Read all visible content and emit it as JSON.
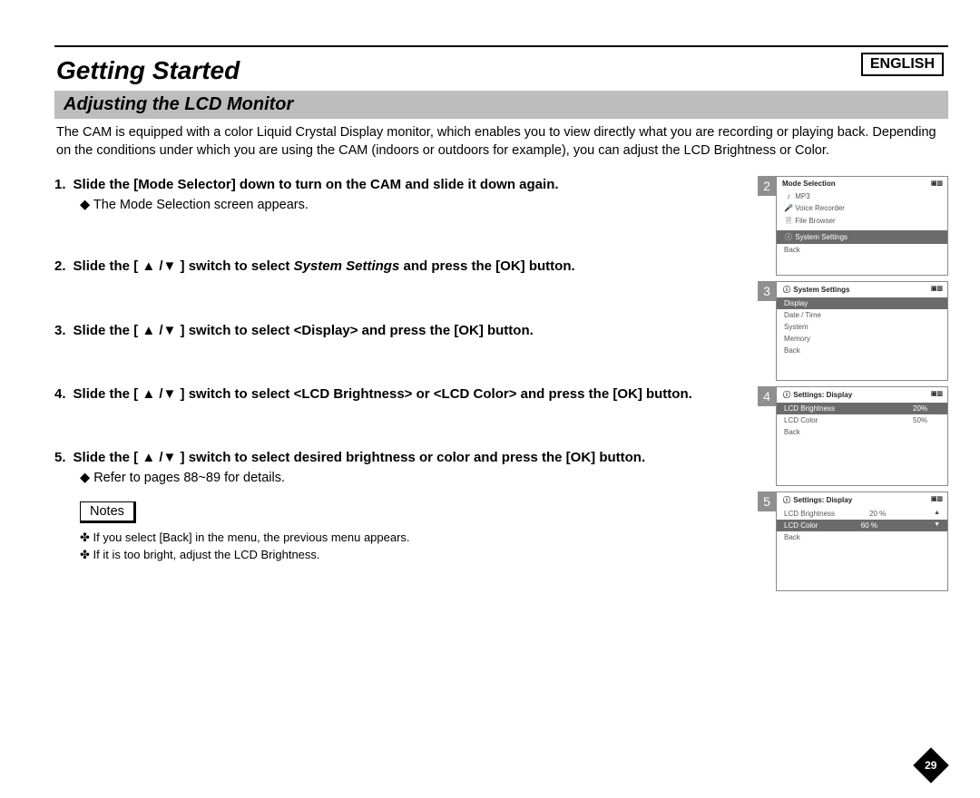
{
  "language": "ENGLISH",
  "page_title": "Getting Started",
  "section_title": "Adjusting the LCD Monitor",
  "intro": "The CAM is equipped with a color Liquid Crystal Display monitor, which enables you to view directly what you are recording or playing back. Depending on the conditions under which you are using the CAM (indoors or outdoors for example), you can adjust the LCD Brightness or Color.",
  "steps": [
    {
      "num": "1.",
      "text": "Slide the [Mode Selector] down to turn on the CAM and slide it down again.",
      "sub": "The Mode Selection screen appears."
    },
    {
      "num": "2.",
      "prefix": "Slide the [ ▲ /▼ ] switch to select ",
      "emph": "System Settings",
      "suffix": " and press the [OK] button."
    },
    {
      "num": "3.",
      "text": "Slide the [ ▲ /▼ ] switch to select <Display> and press the [OK] button."
    },
    {
      "num": "4.",
      "text": "Slide the [ ▲ /▼ ] switch to select <LCD Brightness> or <LCD Color> and press the [OK] button."
    },
    {
      "num": "5.",
      "text": "Slide the [ ▲ /▼ ] switch to select desired brightness or color and press the [OK] button.",
      "sub": "Refer to pages 88~89 for details."
    }
  ],
  "notes_label": "Notes",
  "notes": [
    "If you select [Back] in the menu, the previous menu appears.",
    "If it is too bright, adjust the LCD Brightness."
  ],
  "panels": {
    "p2": {
      "title": "Mode Selection",
      "items": [
        "MP3",
        "Voice Recorder",
        "File Browser",
        "System Settings",
        "Back"
      ],
      "selected": "System Settings",
      "icons": [
        "♪",
        "🎤",
        "🗎",
        "ⓘ",
        ""
      ]
    },
    "p3": {
      "title": "System Settings",
      "items": [
        "Display",
        "Date / Time",
        "System",
        "Memory",
        "Back"
      ],
      "selected": "Display"
    },
    "p4": {
      "title": "Settings: Display",
      "rows": [
        {
          "label": "LCD Brightness",
          "value": "20%",
          "sel": true
        },
        {
          "label": "LCD Color",
          "value": "50%",
          "sel": false
        },
        {
          "label": "Back",
          "value": "",
          "sel": false
        }
      ]
    },
    "p5": {
      "title": "Settings: Display",
      "rows": [
        {
          "label": "LCD Brightness",
          "value": "20 %",
          "sel": false
        },
        {
          "label": "LCD Color",
          "value": "60 %",
          "sel": true
        },
        {
          "label": "Back",
          "value": "",
          "sel": false
        }
      ]
    }
  },
  "indicators": "▣ ▥",
  "page_number": "29"
}
